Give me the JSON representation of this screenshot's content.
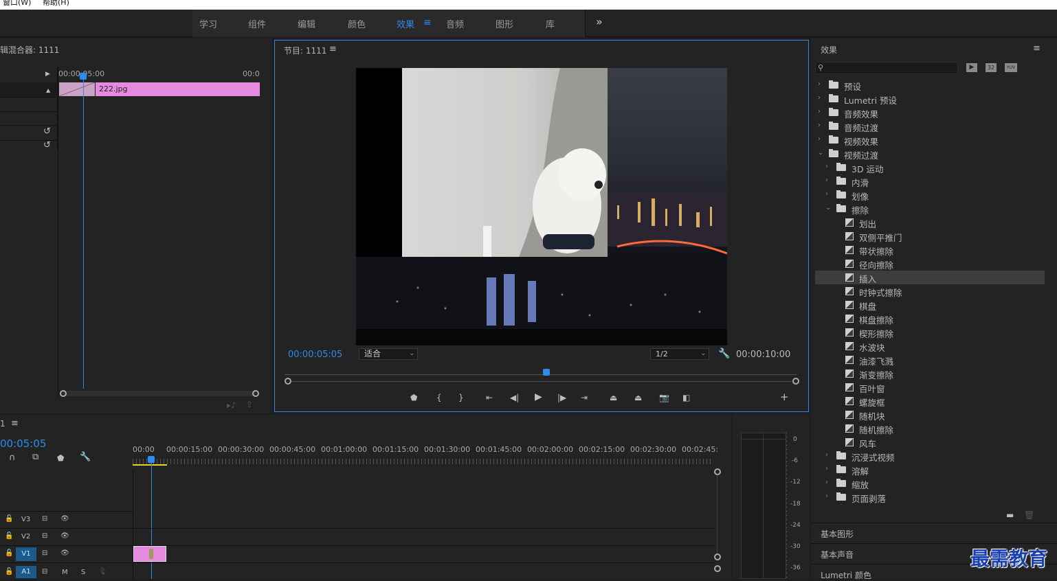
{
  "menubar": {
    "window": "窗口(W)",
    "help": "帮助(H)"
  },
  "workspaces": {
    "tabs": [
      "学习",
      "组件",
      "编辑",
      "颜色",
      "效果",
      "音频",
      "图形",
      "库"
    ],
    "active": "效果",
    "more": "»"
  },
  "source_panel": {
    "title": "辑混合器: 1111",
    "time_start": "00:00:05:00",
    "time_end": "00:0",
    "clip_name": "222.jpg"
  },
  "program": {
    "title": "节目: 1111",
    "timecode": "00:00:05:05",
    "fit": "适合",
    "resolution": "1/2",
    "duration": "00:00:10:00"
  },
  "timeline": {
    "tab": "1",
    "timecode": "00:05:05",
    "ruler": [
      "00:00",
      "00:00:15:00",
      "00:00:30:00",
      "00:00:45:00",
      "00:01:00:00",
      "00:01:15:00",
      "00:01:30:00",
      "00:01:45:00",
      "00:02:00:00",
      "00:02:15:00",
      "00:02:30:00",
      "00:02:45:"
    ],
    "tracks": [
      "V3",
      "V2",
      "V1",
      "A1"
    ],
    "track_m": "M",
    "track_s": "S"
  },
  "meter": {
    "labels": [
      "0",
      "-6",
      "-12",
      "-18",
      "-24",
      "-30",
      "-36"
    ]
  },
  "effects": {
    "title": "效果",
    "tree": [
      {
        "label": "预设",
        "level": 0,
        "type": "folder",
        "open": false
      },
      {
        "label": "Lumetri 预设",
        "level": 0,
        "type": "folder",
        "open": false
      },
      {
        "label": "音频效果",
        "level": 0,
        "type": "folder",
        "open": false
      },
      {
        "label": "音频过渡",
        "level": 0,
        "type": "folder",
        "open": false
      },
      {
        "label": "视频效果",
        "level": 0,
        "type": "folder",
        "open": false
      },
      {
        "label": "视频过渡",
        "level": 0,
        "type": "folder",
        "open": true
      },
      {
        "label": "3D 运动",
        "level": 1,
        "type": "folder",
        "open": false
      },
      {
        "label": "内滑",
        "level": 1,
        "type": "folder",
        "open": false
      },
      {
        "label": "划像",
        "level": 1,
        "type": "folder",
        "open": false
      },
      {
        "label": "擦除",
        "level": 1,
        "type": "folder",
        "open": true
      },
      {
        "label": "划出",
        "level": 2,
        "type": "fx"
      },
      {
        "label": "双侧平推门",
        "level": 2,
        "type": "fx"
      },
      {
        "label": "带状擦除",
        "level": 2,
        "type": "fx"
      },
      {
        "label": "径向擦除",
        "level": 2,
        "type": "fx"
      },
      {
        "label": "插入",
        "level": 2,
        "type": "fx",
        "selected": true
      },
      {
        "label": "时钟式擦除",
        "level": 2,
        "type": "fx"
      },
      {
        "label": "棋盘",
        "level": 2,
        "type": "fx"
      },
      {
        "label": "棋盘擦除",
        "level": 2,
        "type": "fx"
      },
      {
        "label": "楔形擦除",
        "level": 2,
        "type": "fx"
      },
      {
        "label": "水波块",
        "level": 2,
        "type": "fx"
      },
      {
        "label": "油漆飞溅",
        "level": 2,
        "type": "fx"
      },
      {
        "label": "渐变擦除",
        "level": 2,
        "type": "fx"
      },
      {
        "label": "百叶窗",
        "level": 2,
        "type": "fx"
      },
      {
        "label": "螺旋框",
        "level": 2,
        "type": "fx"
      },
      {
        "label": "随机块",
        "level": 2,
        "type": "fx"
      },
      {
        "label": "随机擦除",
        "level": 2,
        "type": "fx"
      },
      {
        "label": "风车",
        "level": 2,
        "type": "fx"
      },
      {
        "label": "沉浸式视频",
        "level": 1,
        "type": "folder",
        "open": false
      },
      {
        "label": "溶解",
        "level": 1,
        "type": "folder",
        "open": false
      },
      {
        "label": "缩放",
        "level": 1,
        "type": "folder",
        "open": false
      },
      {
        "label": "页面剥落",
        "level": 1,
        "type": "folder",
        "open": false
      }
    ],
    "sections": [
      "基本图形",
      "基本声音",
      "Lumetri 颜色"
    ],
    "badge_32": "32",
    "badge_yuv": "YUV"
  },
  "watermark": "最需教育",
  "colors": {
    "accent": "#2d8ceb",
    "clip": "#e58ae0"
  }
}
